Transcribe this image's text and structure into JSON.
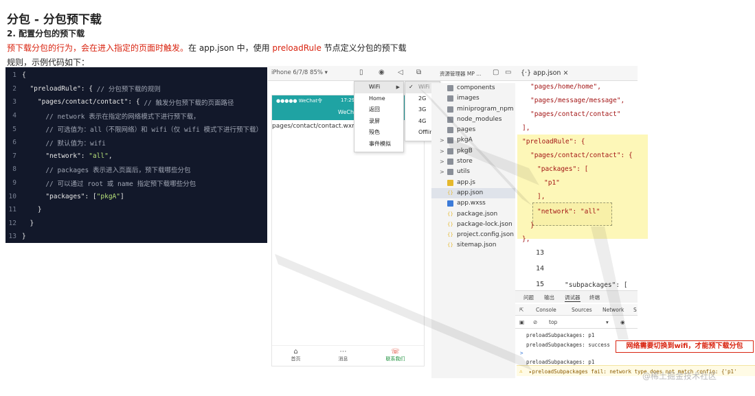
{
  "article": {
    "title": "分包 - 分包预下载",
    "subtitle": "2. 配置分包的预下载",
    "intro_red": "预下载分包的行为，会在进入指定的页面时触发。",
    "intro_mid": "在 app.json 中，使用 ",
    "intro_key": "preloadRule",
    "intro_end": " 节点定义分包的预下载",
    "intro2": "规则，示例代码如下："
  },
  "code_sample": {
    "lines": [
      {
        "n": "1",
        "t": "{",
        "c": ""
      },
      {
        "n": "2",
        "t": "  \"preloadRule\": { ",
        "c": "// 分包预下载的规则"
      },
      {
        "n": "3",
        "t": "    \"pages/contact/contact\": { ",
        "c": "// 触发分包预下载的页面路径"
      },
      {
        "n": "4",
        "t": "      ",
        "c": "// network 表示在指定的网络模式下进行预下载，"
      },
      {
        "n": "5",
        "t": "      ",
        "c": "// 可选值为：all（不限网络）和 wifi（仅 wifi 模式下进行预下载）"
      },
      {
        "n": "6",
        "t": "      ",
        "c": "// 默认值为：wifi"
      },
      {
        "n": "7",
        "t": "      \"network\": ",
        "g": "\"all\"",
        "e": ","
      },
      {
        "n": "8",
        "t": "      ",
        "c": "// packages 表示进入页面后，预下载哪些分包"
      },
      {
        "n": "9",
        "t": "      ",
        "c": "// 可以通过 root 或 name 指定预下载哪些分包"
      },
      {
        "n": "10",
        "t": "      \"packages\": [",
        "g": "\"pkgA\"",
        "e": "]"
      },
      {
        "n": "11",
        "t": "    }",
        "c": ""
      },
      {
        "n": "12",
        "t": "  }",
        "c": ""
      },
      {
        "n": "13",
        "t": "}",
        "c": ""
      }
    ]
  },
  "simulator": {
    "device": "iPhone 6/7/8 85% ▾",
    "status_left": "●●●●● WeChat令",
    "status_time": "17:29",
    "nav_title": "WeCh",
    "page_path": "pages/contact/contact.wxml",
    "tabs": [
      {
        "label": "首页",
        "icon": "⌂"
      },
      {
        "label": "消息",
        "icon": "⋯"
      },
      {
        "label": "联系我们",
        "icon": "☏"
      }
    ]
  },
  "network_menu": {
    "items": [
      "WiFi",
      "Home",
      "返回",
      "录屏",
      "殁色",
      "事件模拟"
    ],
    "submenu": [
      "WiFi",
      "2G",
      "3G",
      "4G",
      "Offline"
    ],
    "submenu_checked": "WiFi"
  },
  "file_tree": {
    "header": "资源管理器  MP ...",
    "items": [
      {
        "name": "components",
        "type": "folder",
        "arrow": ""
      },
      {
        "name": "images",
        "type": "folder",
        "arrow": ""
      },
      {
        "name": "miniprogram_npm",
        "type": "folder",
        "arrow": ""
      },
      {
        "name": "node_modules",
        "type": "folder",
        "arrow": ""
      },
      {
        "name": "pages",
        "type": "folder",
        "arrow": ""
      },
      {
        "name": "pkgA",
        "type": "folder",
        "arrow": ">"
      },
      {
        "name": "pkgB",
        "type": "folder",
        "arrow": ">"
      },
      {
        "name": "store",
        "type": "folder",
        "arrow": ">"
      },
      {
        "name": "utils",
        "type": "folder",
        "arrow": ">"
      },
      {
        "name": "app.js",
        "type": "js",
        "arrow": ""
      },
      {
        "name": "app.json",
        "type": "json",
        "arrow": ""
      },
      {
        "name": "app.wxss",
        "type": "wxss",
        "arrow": ""
      },
      {
        "name": "package.json",
        "type": "json",
        "arrow": ""
      },
      {
        "name": "package-lock.json",
        "type": "json",
        "arrow": ""
      },
      {
        "name": "project.config.json",
        "type": "json",
        "arrow": ""
      },
      {
        "name": "sitemap.json",
        "type": "json",
        "arrow": ""
      }
    ],
    "selected": "app.json"
  },
  "editor": {
    "tab_label": "{·} app.json  ×",
    "code": [
      "\"pages/home/home\",",
      "\"pages/message/message\",",
      "\"pages/contact/contact\"",
      "],",
      "\"preloadRule\": {",
      "\"pages/contact/contact\": {",
      "\"packages\": [",
      "\"p1\"",
      "],",
      "\"network\": \"all\"",
      "}",
      "},"
    ],
    "line_numbers": [
      "13",
      "14",
      "15"
    ],
    "subpackages_line": "\"subpackages\": ["
  },
  "devtools": {
    "panel_tabs": [
      "问题",
      "输出",
      "调试器",
      "终端"
    ],
    "sub_tabs": [
      "Console",
      "Sources",
      "Network",
      "S"
    ],
    "context": "top",
    "logs": [
      "preloadSubpackages: p1",
      "preloadSubpackages: success",
      "preloadSubpackages: p1",
      "▸preloadSubpackages fail: network type does not match config: {'p1'"
    ],
    "prompt": ">"
  },
  "annotation": {
    "callout": "网络需要切换到wifi，才能预下载分包",
    "watermark": "@稀土掘金技术社区"
  },
  "colors": {
    "code_bg": "#12182a",
    "highlight": "#fdf7b8",
    "accent_red": "#d9230f",
    "wechat_teal": "#1fa3a3"
  }
}
